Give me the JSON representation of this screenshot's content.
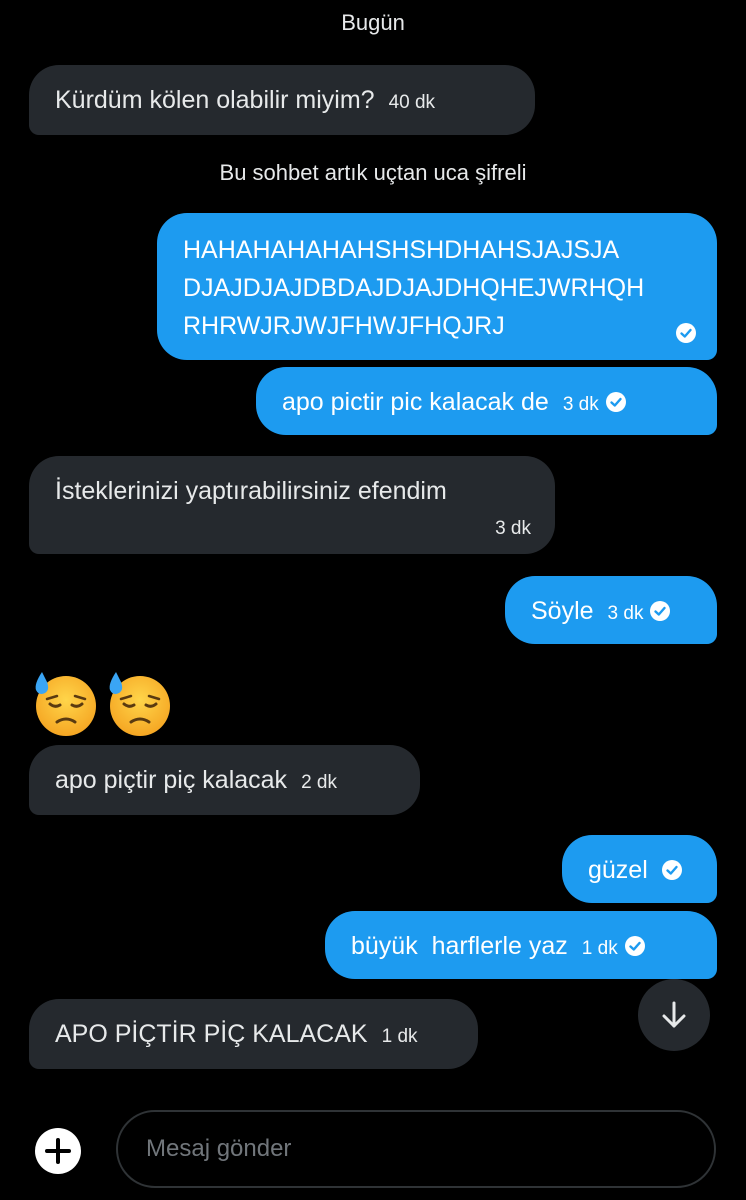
{
  "day_separator": "Bugün",
  "encryption_notice": "Bu sohbet artık uçtan uca şifreli",
  "messages": [
    {
      "text": "Kürdüm kölen olabilir miyim?",
      "time": "40 dk"
    },
    {
      "lines": [
        "HAHAHAHAHAHSHSHDHAHSJAJSJA",
        "DJAJDJAJDBDAJDJAJDHQHEJWRHQH",
        "RHRWJRJWJFHWJFHQJRJ"
      ]
    },
    {
      "text": "apo pictir pic kalacak de",
      "time": "3 dk"
    },
    {
      "text": "İsteklerinizi yaptırabilirsiniz efendim",
      "time": "3 dk"
    },
    {
      "text": "Söyle",
      "time": "3 dk"
    },
    {
      "text": "apo piçtir piç kalacak",
      "time": "2 dk"
    },
    {
      "text": "güzel"
    },
    {
      "text": "büyük  harflerle yaz",
      "time": "1 dk"
    },
    {
      "text": "APO PİÇTİR PİÇ KALACAK",
      "time": "1 dk"
    }
  ],
  "emoji": [
    "downcast-face-with-sweat",
    "downcast-face-with-sweat"
  ],
  "composer": {
    "placeholder": "Mesaj gönder"
  },
  "colors": {
    "sent_bubble": "#1d9bf0",
    "received_bubble": "#25292e",
    "background": "#000000"
  }
}
